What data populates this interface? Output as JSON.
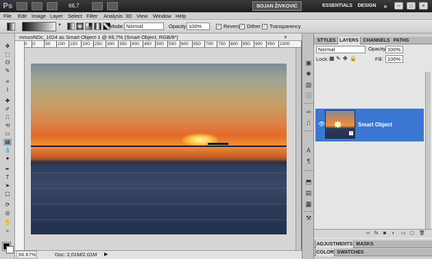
{
  "app_bar": {
    "logo": "Ps",
    "zoom": "66,7",
    "workspace_user": "BOJAN ŽIVKOVIĆ",
    "workspace_essentials": "ESSENTIALS",
    "workspace_design": "DESIGN",
    "more": "»",
    "window_buttons": [
      "–",
      "□",
      "×"
    ]
  },
  "menu": [
    "File",
    "Edit",
    "Image",
    "Layer",
    "Select",
    "Filter",
    "Analysis",
    "3D",
    "View",
    "Window",
    "Help"
  ],
  "options": {
    "mode_label": "Mode:",
    "mode_value": "Normal",
    "opacity_label": "Opacity:",
    "opacity_value": "100%",
    "reverse_label": "Reverse",
    "dither_label": "Dither",
    "transparency_label": "Transparency",
    "reverse_checked": true,
    "dither_checked": true,
    "transparency_checked": true
  },
  "tools": [
    "move-tool",
    "marquee-tool",
    "lasso-tool",
    "quick-select-tool",
    "crop-tool",
    "eyedropper-tool",
    "healing-brush-tool",
    "brush-tool",
    "clone-stamp-tool",
    "history-brush-tool",
    "eraser-tool",
    "gradient-tool",
    "blur-tool",
    "dodge-tool",
    "pen-tool",
    "type-tool",
    "path-select-tool",
    "shape-tool",
    "3d-rotate-tool",
    "3d-camera-tool",
    "hand-tool",
    "zoom-tool"
  ],
  "document": {
    "tab_title": "mmzoNDc_1024 as Smart Object-1 @ 66,7% (Smart Object, RGB/8*)",
    "close": "×",
    "ruler_ticks": [
      "0",
      "0",
      "50",
      "100",
      "150",
      "200",
      "250",
      "300",
      "350",
      "400",
      "450",
      "500",
      "550",
      "600",
      "650",
      "700",
      "750",
      "800",
      "850",
      "900",
      "950",
      "1000"
    ],
    "zoom_status": "66.67%",
    "doc_size": "Doc: 2,01M/2,01M",
    "status_arrow": "▶"
  },
  "panel": {
    "tabs": [
      "STYLES",
      "LAYERS",
      "CHANNELS",
      "PATHS"
    ],
    "selected_tab": "LAYERS",
    "blend_mode": "Normal",
    "opacity_label": "Opacity:",
    "opacity_value": "100%",
    "lock_label": "Lock:",
    "fill_label": "Fill:",
    "fill_value": "100%",
    "layer_name": "Smart Object",
    "footer_icons": [
      "link-icon",
      "fx-icon",
      "mask-icon",
      "adjustment-icon",
      "folder-icon",
      "new-layer-icon",
      "trash-icon"
    ],
    "footer_glyphs": [
      "∞",
      "fx",
      "◙",
      "◐",
      "▭",
      "▢",
      "🗑"
    ],
    "panel2_tabs": [
      "ADJUSTMENTS",
      "MASKS"
    ],
    "panel3_tabs": [
      "COLOR",
      "SWATCHES"
    ]
  }
}
